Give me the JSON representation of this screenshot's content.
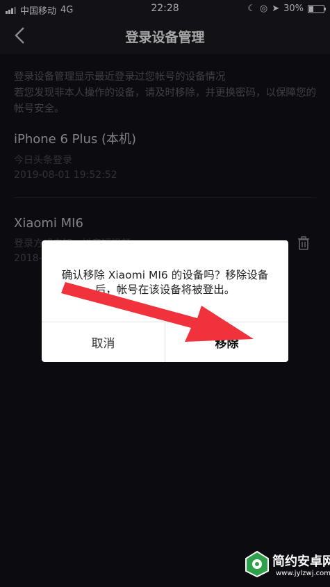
{
  "status_bar": {
    "carrier": "中国移动",
    "network": "4G",
    "time": "22:28",
    "battery": "30%",
    "battery_level": 0.3
  },
  "nav": {
    "title": "登录设备管理"
  },
  "info": {
    "line1": "登录设备管理显示最近登录过您帐号的设备情况",
    "line2": "若您发现非本人操作的设备，请及时移除，并更换密码，以保障您的帐号安全。"
  },
  "devices": [
    {
      "name": "iPhone 6 Plus (本机)",
      "app": "今日头条登录",
      "time": "2019-08-01 19:52:52"
    },
    {
      "name": "Xiaomi MI6",
      "app": "登录方式未知，抖音短视频",
      "time": "2018-"
    }
  ],
  "dialog": {
    "message": "确认移除 Xiaomi MI6 的设备吗？移除设备后，帐号在该设备将被登出。",
    "cancel_label": "取消",
    "confirm_label": "移除"
  },
  "watermark": {
    "brand": "简约安卓网",
    "url": "www.jylzwj.com"
  },
  "colors": {
    "arrow": "#f0323c",
    "background": "#121219"
  }
}
